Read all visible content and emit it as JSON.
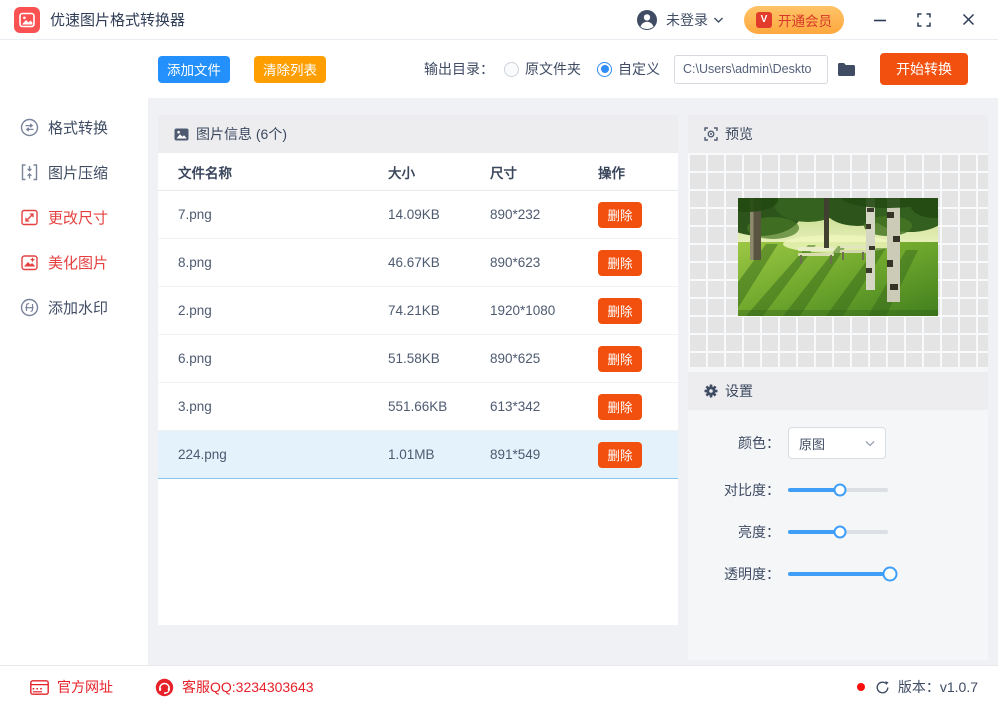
{
  "window": {
    "title": "优速图片格式转换器"
  },
  "titlebar": {
    "login_text": "未登录",
    "vip_label": "开通会员"
  },
  "toolbar": {
    "add_files": "添加文件",
    "clear_list": "清除列表",
    "output_dir_label": "输出目录：",
    "radio_original": "原文件夹",
    "radio_custom": "自定义",
    "path_value": "C:\\Users\\admin\\Deskto",
    "start_convert": "开始转换"
  },
  "sidebar": {
    "items": [
      {
        "label": "格式转换",
        "active": false
      },
      {
        "label": "图片压缩",
        "active": false
      },
      {
        "label": "更改尺寸",
        "active": true
      },
      {
        "label": "美化图片",
        "active": true
      },
      {
        "label": "添加水印",
        "active": false
      }
    ]
  },
  "file_table": {
    "title": "图片信息 (6个)",
    "headers": {
      "name": "文件名称",
      "size": "大小",
      "dimension": "尺寸",
      "action": "操作"
    },
    "delete_label": "删除",
    "rows": [
      {
        "name": "7.png",
        "size": "14.09KB",
        "dimension": "890*232",
        "selected": false
      },
      {
        "name": "8.png",
        "size": "46.67KB",
        "dimension": "890*623",
        "selected": false
      },
      {
        "name": "2.png",
        "size": "74.21KB",
        "dimension": "1920*1080",
        "selected": false
      },
      {
        "name": "6.png",
        "size": "51.58KB",
        "dimension": "890*625",
        "selected": false
      },
      {
        "name": "3.png",
        "size": "551.66KB",
        "dimension": "613*342",
        "selected": false
      },
      {
        "name": "224.png",
        "size": "1.01MB",
        "dimension": "891*549",
        "selected": true
      }
    ]
  },
  "preview": {
    "title": "预览"
  },
  "settings": {
    "title": "设置",
    "color_label": "颜色：",
    "color_value": "原图",
    "sliders": [
      {
        "label": "对比度：",
        "percent": 52
      },
      {
        "label": "亮度：",
        "percent": 52
      },
      {
        "label": "透明度：",
        "percent": 96
      }
    ]
  },
  "footer": {
    "website_label": "官方网址",
    "support_qq": "客服QQ:3234303643",
    "version_label": "版本：v1.0.7"
  },
  "colors": {
    "primary_blue": "#2490fb",
    "warning_orange": "#ff9e00",
    "action_red": "#f2500f",
    "brand_red": "#fa5252",
    "active_red": "#e64040",
    "vip_bg": "#ffb14e",
    "vip_text": "#d5372a",
    "footer_red": "#e62129",
    "navy": "#2e3c55",
    "slider_blue": "#3f9ef7",
    "selected_row_bg": "#e4f2fc"
  }
}
